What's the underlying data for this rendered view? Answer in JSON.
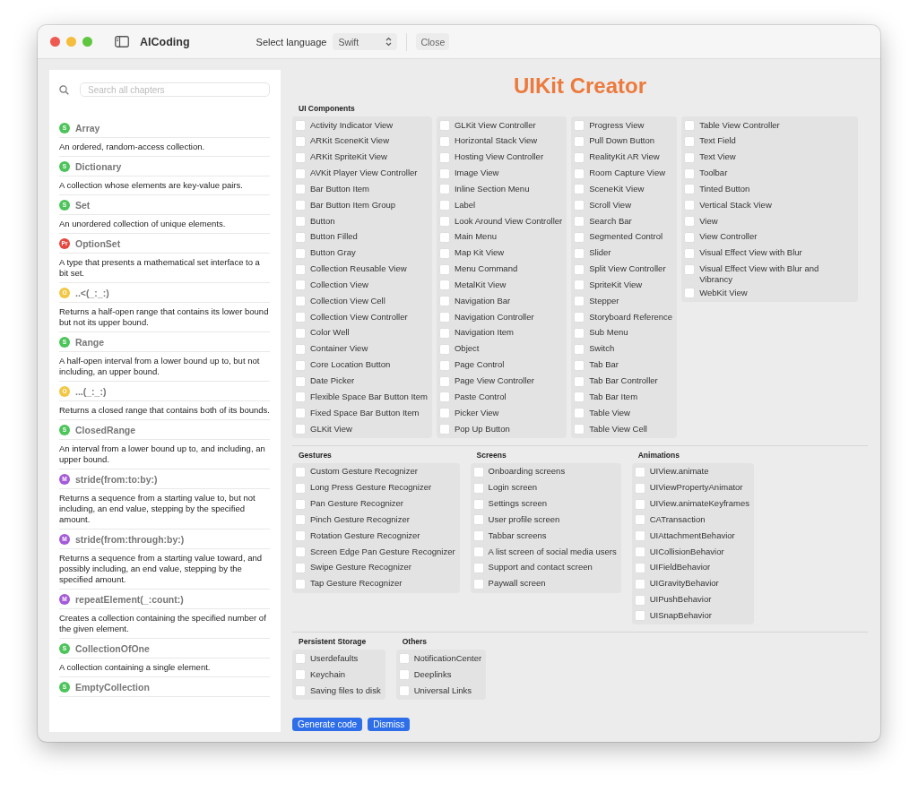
{
  "window": {
    "title": "AICoding"
  },
  "toolbar": {
    "language_label": "Select language",
    "language": "Swift",
    "close": "Close"
  },
  "sidebar": {
    "search": {
      "placeholder": "Search all chapters"
    },
    "items": [
      {
        "badge": "S",
        "color": "#4cc45a",
        "name": "Array",
        "description": "An ordered, random-access collection."
      },
      {
        "badge": "S",
        "color": "#4cc45a",
        "name": "Dictionary",
        "description": "A collection whose elements are key-value pairs."
      },
      {
        "badge": "S",
        "color": "#4cc45a",
        "name": "Set",
        "description": "An unordered collection of unique elements."
      },
      {
        "badge": "Pr",
        "color": "#e5483f",
        "name": "OptionSet",
        "description": "A type that presents a mathematical set interface to a bit set."
      },
      {
        "badge": "O",
        "color": "#f2c744",
        "name": "..<(_:_:)",
        "description": "Returns a half-open range that contains its lower bound but not its upper bound."
      },
      {
        "badge": "S",
        "color": "#4cc45a",
        "name": "Range",
        "description": "A half-open interval from a lower bound up to, but not including, an upper bound."
      },
      {
        "badge": "O",
        "color": "#f2c744",
        "name": "...(_:_:)",
        "description": "Returns a closed range that contains both of its bounds."
      },
      {
        "badge": "S",
        "color": "#4cc45a",
        "name": "ClosedRange",
        "description": "An interval from a lower bound up to, and including, an upper bound."
      },
      {
        "badge": "M",
        "color": "#a55bd8",
        "name": "stride(from:to:by:)",
        "description": "Returns a sequence from a starting value to, but not including, an end value, stepping by the specified amount."
      },
      {
        "badge": "M",
        "color": "#a55bd8",
        "name": "stride(from:through:by:)",
        "description": "Returns a sequence from a starting value toward, and possibly including, an end value, stepping by the specified amount."
      },
      {
        "badge": "M",
        "color": "#a55bd8",
        "name": "repeatElement(_:count:)",
        "description": "Creates a collection containing the specified number of the given element."
      },
      {
        "badge": "S",
        "color": "#4cc45a",
        "name": "CollectionOfOne",
        "description": "A collection containing a single element."
      },
      {
        "badge": "S",
        "color": "#4cc45a",
        "name": "EmptyCollection"
      }
    ]
  },
  "heading": "UIKit Creator",
  "section_rows": [
    [
      {
        "title": "UI Components",
        "columns": [
          [
            {
              "label": "Activity Indicator View",
              "checked": false
            },
            {
              "label": "ARKit SceneKit View",
              "checked": false
            },
            {
              "label": "ARKit SpriteKit View",
              "checked": false
            },
            {
              "label": "AVKit Player View Controller",
              "checked": false
            },
            {
              "label": "Bar Button Item",
              "checked": false
            },
            {
              "label": "Bar Button Item Group",
              "checked": false
            },
            {
              "label": "Button",
              "checked": false
            },
            {
              "label": "Button Filled",
              "checked": false
            },
            {
              "label": "Button Gray",
              "checked": false
            },
            {
              "label": "Collection Reusable View",
              "checked": false
            },
            {
              "label": "Collection View",
              "checked": false
            },
            {
              "label": "Collection View Cell",
              "checked": false
            },
            {
              "label": "Collection View Controller",
              "checked": false
            },
            {
              "label": "Color Well",
              "checked": false
            },
            {
              "label": "Container View",
              "checked": false
            },
            {
              "label": "Core Location Button",
              "checked": false
            },
            {
              "label": "Date Picker",
              "checked": false
            },
            {
              "label": "Flexible Space Bar Button Item",
              "checked": false
            },
            {
              "label": "Fixed Space Bar Button Item",
              "checked": false
            },
            {
              "label": "GLKit View",
              "checked": false
            }
          ],
          [
            {
              "label": "GLKit View Controller",
              "checked": false
            },
            {
              "label": "Horizontal Stack View",
              "checked": false
            },
            {
              "label": "Hosting View Controller",
              "checked": false
            },
            {
              "label": "Image View",
              "checked": false
            },
            {
              "label": "Inline Section Menu",
              "checked": false
            },
            {
              "label": "Label",
              "checked": false
            },
            {
              "label": "Look Around View Controller",
              "checked": false
            },
            {
              "label": "Main Menu",
              "checked": false
            },
            {
              "label": "Map Kit View",
              "checked": false
            },
            {
              "label": "Menu Command",
              "checked": false
            },
            {
              "label": "MetalKit View",
              "checked": false
            },
            {
              "label": "Navigation Bar",
              "checked": false
            },
            {
              "label": "Navigation Controller",
              "checked": false
            },
            {
              "label": "Navigation Item",
              "checked": false
            },
            {
              "label": "Object",
              "checked": false
            },
            {
              "label": "Page Control",
              "checked": false
            },
            {
              "label": "Page View Controller",
              "checked": false
            },
            {
              "label": "Paste Control",
              "checked": false
            },
            {
              "label": "Picker View",
              "checked": false
            },
            {
              "label": "Pop Up Button",
              "checked": false
            }
          ],
          [
            {
              "label": "Progress View",
              "checked": false
            },
            {
              "label": "Pull Down Button",
              "checked": false
            },
            {
              "label": "RealityKit AR View",
              "checked": false
            },
            {
              "label": "Room Capture View",
              "checked": false
            },
            {
              "label": "SceneKit View",
              "checked": false
            },
            {
              "label": "Scroll View",
              "checked": false
            },
            {
              "label": "Search Bar",
              "checked": false
            },
            {
              "label": "Segmented Control",
              "checked": false
            },
            {
              "label": "Slider",
              "checked": false
            },
            {
              "label": "Split View Controller",
              "checked": false
            },
            {
              "label": "SpriteKit View",
              "checked": false
            },
            {
              "label": "Stepper",
              "checked": false
            },
            {
              "label": "Storyboard Reference",
              "checked": false
            },
            {
              "label": "Sub Menu",
              "checked": false
            },
            {
              "label": "Switch",
              "checked": false
            },
            {
              "label": "Tab Bar",
              "checked": false
            },
            {
              "label": "Tab Bar Controller",
              "checked": false
            },
            {
              "label": "Tab Bar Item",
              "checked": false
            },
            {
              "label": "Table View",
              "checked": false
            },
            {
              "label": "Table View Cell",
              "checked": false
            }
          ],
          [
            {
              "label": "Table View Controller",
              "checked": false
            },
            {
              "label": "Text Field",
              "checked": false
            },
            {
              "label": "Text View",
              "checked": false
            },
            {
              "label": "Toolbar",
              "checked": false
            },
            {
              "label": "Tinted Button",
              "checked": false
            },
            {
              "label": "Vertical Stack View",
              "checked": false
            },
            {
              "label": "View",
              "checked": false
            },
            {
              "label": "View Controller",
              "checked": false
            },
            {
              "label": "Visual Effect View with Blur",
              "checked": false
            },
            {
              "label": "Visual Effect View with Blur and Vibrancy",
              "checked": false
            },
            {
              "label": "WebKit View",
              "checked": false
            }
          ]
        ]
      }
    ],
    [
      {
        "title": "Gestures",
        "columns": [
          [
            {
              "label": "Custom Gesture Recognizer",
              "checked": false
            },
            {
              "label": "Long Press Gesture Recognizer",
              "checked": false
            },
            {
              "label": "Pan Gesture Recognizer",
              "checked": false
            },
            {
              "label": "Pinch Gesture Recognizer",
              "checked": false
            },
            {
              "label": "Rotation Gesture Recognizer",
              "checked": false
            },
            {
              "label": "Screen Edge Pan Gesture Recognizer",
              "checked": false
            },
            {
              "label": "Swipe Gesture Recognizer",
              "checked": false
            },
            {
              "label": "Tap Gesture Recognizer",
              "checked": false
            }
          ]
        ]
      },
      {
        "title": "Screens",
        "columns": [
          [
            {
              "label": "Onboarding screens",
              "checked": false
            },
            {
              "label": "Login screen",
              "checked": false
            },
            {
              "label": "Settings screen",
              "checked": false
            },
            {
              "label": "User profile screen",
              "checked": false
            },
            {
              "label": "Tabbar screens",
              "checked": false
            },
            {
              "label": "A list screen of social media users",
              "checked": false
            },
            {
              "label": "Support and contact screen",
              "checked": false
            },
            {
              "label": "Paywall screen",
              "checked": false
            }
          ]
        ]
      },
      {
        "title": "Animations",
        "columns": [
          [
            {
              "label": "UIView.animate",
              "checked": false
            },
            {
              "label": "UIViewPropertyAnimator",
              "checked": false
            },
            {
              "label": "UIView.animateKeyframes",
              "checked": false
            },
            {
              "label": "CATransaction",
              "checked": false
            },
            {
              "label": "UIAttachmentBehavior",
              "checked": false
            },
            {
              "label": "UICollisionBehavior",
              "checked": false
            },
            {
              "label": "UIFieldBehavior",
              "checked": false
            },
            {
              "label": "UIGravityBehavior",
              "checked": false
            },
            {
              "label": "UIPushBehavior",
              "checked": false
            },
            {
              "label": "UISnapBehavior",
              "checked": false
            }
          ]
        ]
      }
    ],
    [
      {
        "title": "Persistent Storage",
        "columns": [
          [
            {
              "label": "Userdefaults",
              "checked": false
            },
            {
              "label": "Keychain",
              "checked": false
            },
            {
              "label": "Saving files to disk",
              "checked": false
            }
          ]
        ]
      },
      {
        "title": "Others",
        "columns": [
          [
            {
              "label": "NotificationCenter",
              "checked": false
            },
            {
              "label": "Deeplinks",
              "checked": false
            },
            {
              "label": "Universal Links",
              "checked": false
            }
          ]
        ]
      }
    ]
  ],
  "buttons": [
    "Generate code",
    "Dismiss"
  ]
}
